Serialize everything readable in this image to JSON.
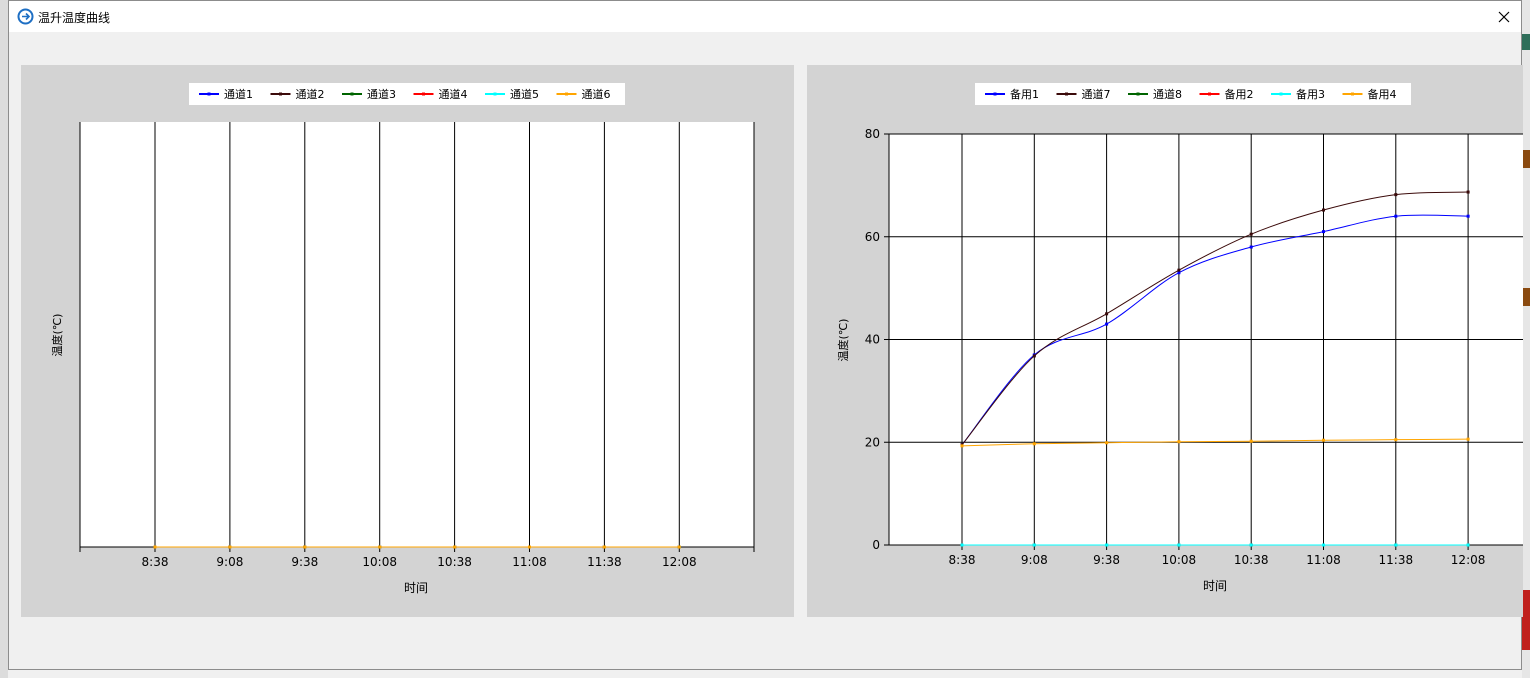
{
  "window": {
    "title": "温升温度曲线"
  },
  "icons": {
    "app": "thermometer-app-icon",
    "close": "close-icon"
  },
  "chart_data": [
    {
      "type": "line",
      "xlabel": "时间",
      "ylabel": "温度(℃)",
      "grid": true,
      "legend_position": "top-center",
      "x_ticks": [
        "8:38",
        "9:08",
        "9:38",
        "10:08",
        "10:38",
        "11:08",
        "11:38",
        "12:08"
      ],
      "y_ticks": [],
      "ylim": [
        0,
        80
      ],
      "series": [
        {
          "name": "通道1",
          "color": "#0000ff",
          "values": [
            0,
            0,
            0,
            0,
            0,
            0,
            0,
            0
          ]
        },
        {
          "name": "通道2",
          "color": "#3b0a0a",
          "values": [
            0,
            0,
            0,
            0,
            0,
            0,
            0,
            0
          ]
        },
        {
          "name": "通道3",
          "color": "#006400",
          "values": [
            0,
            0,
            0,
            0,
            0,
            0,
            0,
            0
          ]
        },
        {
          "name": "通道4",
          "color": "#ff0000",
          "values": [
            0,
            0,
            0,
            0,
            0,
            0,
            0,
            0
          ]
        },
        {
          "name": "通道5",
          "color": "#00ffff",
          "values": [
            0,
            0,
            0,
            0,
            0,
            0,
            0,
            0
          ]
        },
        {
          "name": "通道6",
          "color": "#ffa500",
          "values": [
            0,
            0,
            0,
            0,
            0,
            0,
            0,
            0
          ]
        }
      ]
    },
    {
      "type": "line",
      "xlabel": "时间",
      "ylabel": "温度(℃)",
      "grid": true,
      "legend_position": "top-center",
      "x_ticks": [
        "8:38",
        "9:08",
        "9:38",
        "10:08",
        "10:38",
        "11:08",
        "11:38",
        "12:08"
      ],
      "y_ticks": [
        "0",
        "20",
        "40",
        "60",
        "80"
      ],
      "ylim": [
        0,
        80
      ],
      "series": [
        {
          "name": "备用1",
          "color": "#0000ff",
          "values": [
            19.5,
            37,
            43,
            53,
            58,
            61,
            64,
            64
          ]
        },
        {
          "name": "通道7",
          "color": "#3b0a0a",
          "values": [
            19.5,
            36.8,
            45,
            53.5,
            60.5,
            65.2,
            68.2,
            68.7
          ]
        },
        {
          "name": "通道8",
          "color": "#006400",
          "values": [
            0,
            0,
            0,
            0,
            0,
            0,
            0,
            0
          ]
        },
        {
          "name": "备用2",
          "color": "#ff0000",
          "values": [
            0,
            0,
            0,
            0,
            0,
            0,
            0,
            0
          ]
        },
        {
          "name": "备用3",
          "color": "#00ffff",
          "values": [
            0,
            0,
            0,
            0,
            0,
            0,
            0,
            0
          ]
        },
        {
          "name": "备用4",
          "color": "#ffa500",
          "values": [
            19.3,
            19.7,
            19.9,
            20.1,
            20.2,
            20.4,
            20.5,
            20.6
          ]
        }
      ]
    }
  ]
}
